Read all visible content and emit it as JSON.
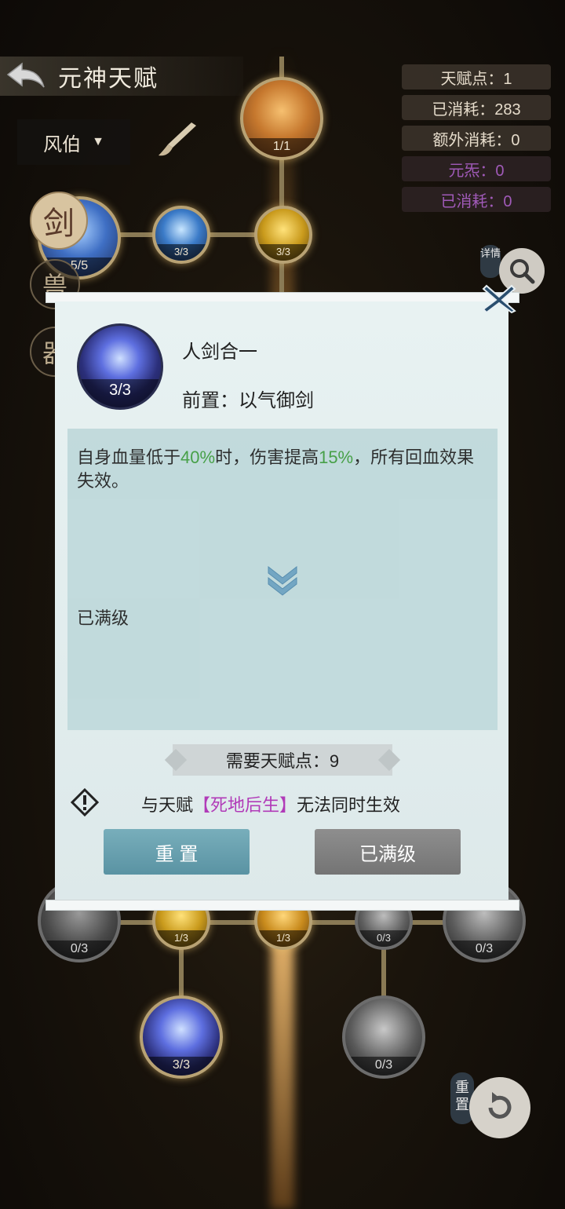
{
  "header": {
    "title": "元神天赋"
  },
  "dropdown": {
    "selected": "风伯"
  },
  "stats": {
    "talent_points": "天赋点：1",
    "consumed": "已消耗：283",
    "extra_consumed": "额外消耗：0",
    "yuansha": "元炁：0",
    "yuansha_consumed": "已消耗：0"
  },
  "side_badges": [
    "剑",
    "兽",
    "器"
  ],
  "detail_tag": "详情",
  "reset_tag": "重置",
  "tree": {
    "top_node": "1/1",
    "row1": [
      "5/5",
      "3/3",
      "3/3"
    ],
    "row_bottom": [
      "0/3",
      "1/3",
      "1/3",
      "0/3",
      "0/3"
    ],
    "row_last": [
      "3/3",
      "0/3"
    ]
  },
  "dialog": {
    "skill_name": "人剑合一",
    "skill_level": "3/3",
    "prereq": "前置：以气御剑",
    "desc_parts": [
      "自身血量低于",
      "40%",
      "时，伤害提高",
      "15%",
      "，所有回血效果失效。"
    ],
    "maxed_text": "已满级",
    "cost": "需要天赋点：9",
    "conflict_prefix": "与天赋",
    "conflict_name": "【死地后生】",
    "conflict_suffix": "无法同时生效",
    "btn_reset": "重 置",
    "btn_max": "已满级"
  },
  "colors": {
    "green": "#3a9a3a",
    "purple": "#b13ab8",
    "reset_btn": "#6aa2b0"
  }
}
